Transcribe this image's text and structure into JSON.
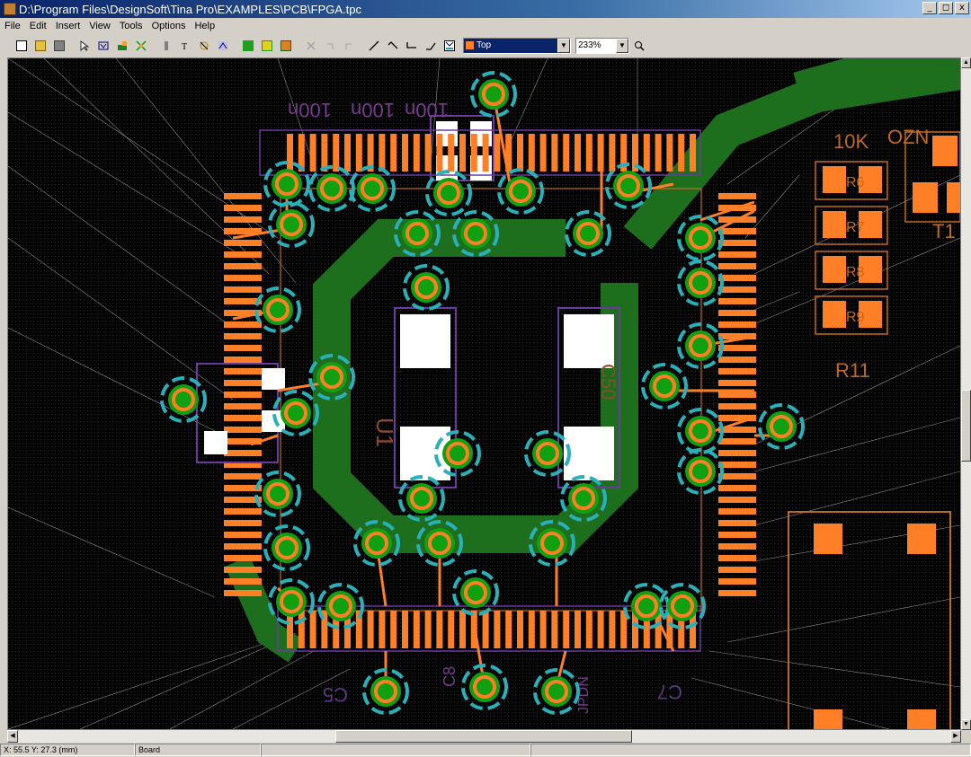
{
  "window": {
    "title": "D:\\Program Files\\DesignSoft\\Tina Pro\\EXAMPLES\\PCB\\FPGA.tpc",
    "minimize": "_",
    "restore": "²",
    "close": "x"
  },
  "menu": {
    "items": [
      {
        "label": "File",
        "key": "F"
      },
      {
        "label": "Edit",
        "key": "E"
      },
      {
        "label": "Insert",
        "key": "I"
      },
      {
        "label": "View",
        "key": "V"
      },
      {
        "label": "Tools",
        "key": "T"
      },
      {
        "label": "Options",
        "key": "O"
      },
      {
        "label": "Help",
        "key": "H"
      }
    ]
  },
  "toolbar": {
    "layer_value": "Top",
    "zoom_value": "233%",
    "icons": [
      "new-file-icon",
      "open-folder-icon",
      "save-icon",
      "select-arrow-icon",
      "pin-select-icon",
      "place-part-icon",
      "net-icon",
      "line-tool-icon",
      "text-tool-icon",
      "dimension-icon",
      "autoroute-icon",
      "layer-green-icon",
      "layer-yellow-icon",
      "layer-orange-icon",
      "delete-icon",
      "undo-icon",
      "redo-icon",
      "track-straight-icon",
      "track-45-icon",
      "track-90-icon",
      "track-diagonal-icon",
      "auto-track-icon",
      "zoom-icon"
    ]
  },
  "board": {
    "colors": {
      "background": "#000000",
      "pad": "#ff7f27",
      "via_ring": "#3cc8c8",
      "via_inner": "#00a000",
      "copper_pour": "#1a6a1a",
      "silkscreen": "#8040b0",
      "outline": "#d06a20",
      "ratsnest": "#ffffff"
    },
    "labels": {
      "u1": "U1",
      "c50": "C50",
      "r11": "R11",
      "r10k": "10K",
      "ozn": "OZN",
      "t1": "T1",
      "c5": "C5",
      "c7": "C7",
      "n100a": "100n",
      "n100b": "100n",
      "n100c": "100n",
      "c8": "C8",
      "jpdn": "JPDN",
      "r6": "R6",
      "r7": "R7",
      "r8": "R8",
      "r9": "R9"
    }
  },
  "statusbar": {
    "coords": "X:  55.5   Y:  27.3  (mm)",
    "mode": "Board"
  }
}
